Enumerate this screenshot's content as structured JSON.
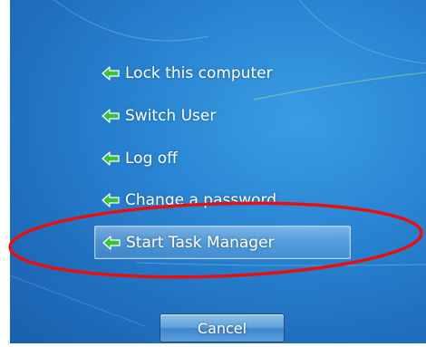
{
  "menu": {
    "items": [
      {
        "label": "Lock this computer"
      },
      {
        "label": "Switch User"
      },
      {
        "label": "Log off"
      },
      {
        "label": "Change a password..."
      },
      {
        "label": "Start Task Manager"
      }
    ]
  },
  "cancel": {
    "label": "Cancel"
  },
  "colors": {
    "background": "#2a86d4",
    "annotation": "#e8100f",
    "arrow_green": "#39c33b"
  },
  "icons": {
    "menu_item": "green-arrow-icon"
  }
}
